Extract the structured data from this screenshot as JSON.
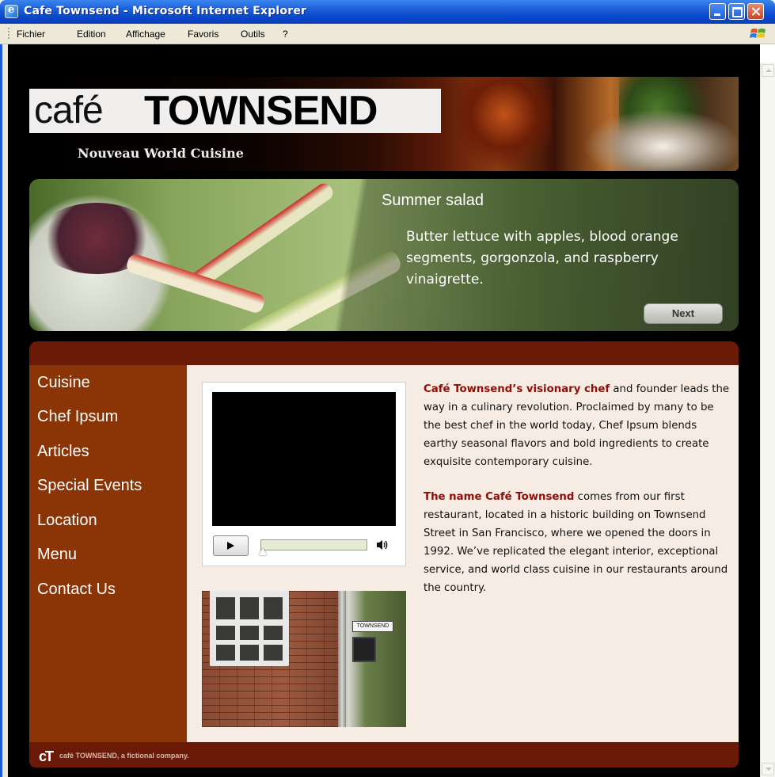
{
  "window": {
    "title": "Cafe Townsend - Microsoft Internet Explorer"
  },
  "menubar": {
    "items": [
      "Fichier",
      "Edition",
      "Affichage",
      "Favoris",
      "Outils",
      "?"
    ]
  },
  "header": {
    "logo_cafe": "café",
    "logo_townsend": "TOWNSEND",
    "tagline": "Nouveau World Cuisine"
  },
  "feature": {
    "title": "Summer salad",
    "description": "Butter lettuce with apples, blood orange segments, gorgonzola, and raspberry vinaigrette.",
    "next_label": "Next"
  },
  "nav": {
    "items": [
      "Cuisine",
      "Chef Ipsum",
      "Articles",
      "Special Events",
      "Location",
      "Menu",
      "Contact Us"
    ]
  },
  "photo": {
    "sign_text": "TOWNSEND"
  },
  "content": {
    "para1_highlight": "Café Townsend’s visionary chef",
    "para1_text": " and founder leads the way in a culinary revolution. Proclaimed by many to be the best chef in the world today, Chef Ipsum blends earthy seasonal flavors and bold ingredients to create exquisite contemporary cuisine.",
    "para2_highlight": "The name Café Townsend",
    "para2_text": " comes from our first restaurant, located in a historic building on Townsend Street in San Francisco, where we opened the doors in 1992. We’ve replicated the elegant interior, exceptional service, and world class cuisine in our restaurants around the country."
  },
  "footer": {
    "logo": "cT",
    "text": "café TOWNSEND, a fictional company."
  },
  "video": {
    "progress": 0
  },
  "colors": {
    "titlebar": "#0a48cc",
    "sidebar": "#8b3406",
    "accent_text": "#8b0f08",
    "content_bg": "#f7ece3"
  }
}
